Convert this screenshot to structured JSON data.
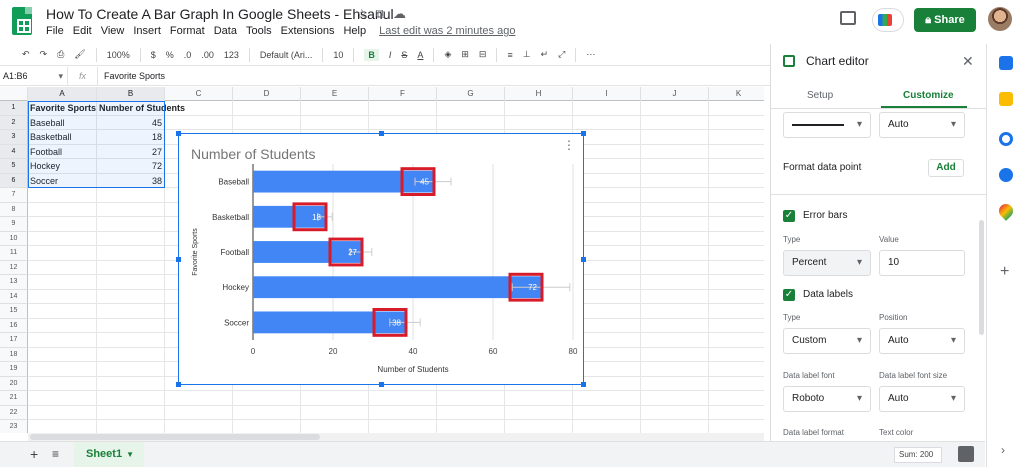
{
  "app": {
    "doc_title": "How To Create A Bar Graph In Google Sheets - Ehsanul",
    "menu": [
      "File",
      "Edit",
      "View",
      "Insert",
      "Format",
      "Data",
      "Tools",
      "Extensions",
      "Help"
    ],
    "last_edit": "Last edit was 2 minutes ago",
    "share_label": "Share"
  },
  "toolbar": {
    "zoom": "100%",
    "currency": "$",
    "percent": "%",
    "decimal_less": ".0",
    "decimal_more": ".00",
    "number_format": "123",
    "font": "Default (Ari...",
    "font_size": "10",
    "bold": "B",
    "italic": "I",
    "strike": "S",
    "text_color": "A"
  },
  "formula_bar": {
    "name_box": "A1:B6",
    "fx": "fx",
    "value": "Favorite Sports"
  },
  "grid": {
    "columns": [
      "A",
      "B",
      "C",
      "D",
      "E",
      "F",
      "G",
      "H",
      "I",
      "J",
      "K"
    ],
    "rows": [
      "1",
      "2",
      "3",
      "4",
      "5",
      "6",
      "7",
      "8",
      "9",
      "10",
      "11",
      "12",
      "13",
      "14",
      "15",
      "16",
      "17",
      "18",
      "19",
      "20",
      "21",
      "22",
      "23"
    ],
    "header": [
      "Favorite Sports",
      "Number of Students"
    ],
    "data": [
      [
        "Baseball",
        "45"
      ],
      [
        "Basketball",
        "18"
      ],
      [
        "Football",
        "27"
      ],
      [
        "Hockey",
        "72"
      ],
      [
        "Soccer",
        "38"
      ]
    ]
  },
  "chart_data": {
    "type": "bar",
    "orientation": "horizontal",
    "title": "Number of Students",
    "categories": [
      "Baseball",
      "Basketball",
      "Football",
      "Hockey",
      "Soccer"
    ],
    "values": [
      45,
      18,
      27,
      72,
      38
    ],
    "data_labels": [
      "45",
      "18",
      "27",
      "72",
      "38"
    ],
    "error_bars": "Percent 10",
    "xlabel": "Number of Students",
    "ylabel": "Favorite Sports",
    "xlim": [
      0,
      80
    ],
    "xticks": [
      "0",
      "20",
      "40",
      "60",
      "80"
    ],
    "grid": true,
    "bar_color": "#4285f4",
    "highlight_color": "#d81b28"
  },
  "sheet_tabs": {
    "active": "Sheet1",
    "sum": "Sum: 200"
  },
  "editor": {
    "title": "Chart editor",
    "tabs": [
      "Setup",
      "Customize"
    ],
    "line_opacity": "Auto",
    "format_data_point": "Format data point",
    "add_label": "Add",
    "error_bars_label": "Error bars",
    "type_label": "Type",
    "value_label": "Value",
    "error_type": "Percent",
    "error_value": "10",
    "data_labels_label": "Data labels",
    "dl_type_label": "Type",
    "dl_position_label": "Position",
    "dl_type": "Custom",
    "dl_position": "Auto",
    "font_label": "Data label font",
    "font_size_label": "Data label font size",
    "font_value": "Roboto",
    "font_size_value": "Auto",
    "format_label": "Data label format",
    "text_color_label": "Text color"
  }
}
